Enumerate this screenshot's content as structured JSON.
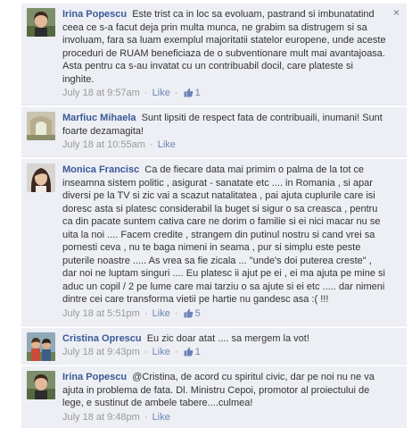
{
  "comments": [
    {
      "author": "Irina Popescu",
      "text": "Este trist ca in loc sa evoluam, pastrand si imbunatatind ceea ce s-a facut deja prin multa munca, ne grabim sa distrugem si sa involuam, fara sa luam exemplul majoritatii statelor europene, unde aceste proceduri de RUAM beneficiaza de o subventionare mult mai avantajoasa. Asta pentru ca s-au invatat cu un contribuabil docil, care plateste si inghite.",
      "time": "July 18 at 9:57am",
      "like_label": "Like",
      "like_count": "1",
      "has_close": true,
      "close_glyph": "×"
    },
    {
      "author": "Marfiuc Mihaela",
      "text": "Sunt lipsiti de respect fata de contribuaili, inumani! Sunt foarte dezamagita!",
      "time": "July 18 at 10:55am",
      "like_label": "Like",
      "like_count": ""
    },
    {
      "author": "Monica Francisc",
      "text": "Ca de fiecare data mai primim o palma de la tot ce inseamna sistem politic , asigurat - sanatate etc .... in Romania , si apar diversi pe la TV si zic vai a scazut natalitatea , pai ajuta cuplurile care isi doresc asta si platesc considerabil la buget si sigur o sa creasca , pentru ca din pacate suntem cativa care ne dorim o familie si ei nici macar nu se uita la noi .... Facem credite , strangem din putinul nostru si cand vrei sa pornesti ceva , nu te baga nimeni in seama , pur si simplu este peste puterile noastre ..... As vrea sa fie zicala ... \"unde's doi puterea creste\" , dar noi ne luptam singuri .... Eu platesc ii ajut pe ei , ei ma ajuta pe mine si aduc un copil / 2 pe lume care mai tarziu o sa ajute si ei etc ..... dar nimeni dintre cei care transforma vietii pe hartie nu gandesc asa :( !!!",
      "time": "July 18 at 5:51pm",
      "like_label": "Like",
      "like_count": "5"
    },
    {
      "author": "Cristina Oprescu",
      "text": "Eu zic doar atat .... sa mergem la vot!",
      "time": "July 18 at 9:43pm",
      "like_label": "Like",
      "like_count": "1"
    },
    {
      "author": "Irina Popescu",
      "text": "@Cristina, de acord cu spiritul civic, dar pe noi nu ne va ajuta in problema de fata. Dl. Ministru Cepoi, promotor al proiectului de lege, e sustinut de ambele tabere....culmea!",
      "time": "July 18 at 9:48pm",
      "like_label": "Like",
      "like_count": ""
    }
  ],
  "separator": "·",
  "colors": {
    "comment_bg": "#edeff4",
    "author_link": "#3b5998",
    "action_link": "#6d84b4",
    "timestamp": "#999999"
  }
}
